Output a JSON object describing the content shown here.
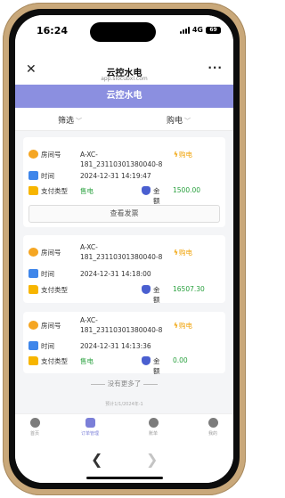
{
  "status_bar": {
    "time": "16:24",
    "network": "4G",
    "battery": "69"
  },
  "nav": {
    "title": "云控水电",
    "subtitle": "app.slocubxl.com",
    "close_label": "✕",
    "more_label": "···"
  },
  "header": {
    "title": "云控水电"
  },
  "filters": {
    "left": "筛选",
    "right": "购电"
  },
  "labels": {
    "room": "房间号",
    "time": "时间",
    "pay_type": "支付类型",
    "amount": "金额"
  },
  "records": [
    {
      "room": "A-XC-181_23110301380040-8",
      "time": "2024-12-31 14:19:47",
      "pay_type": "售电",
      "amount": "1500.00",
      "tag": "购电"
    },
    {
      "room": "A-XC-181_23110301380040-8",
      "time": "2024-12-31 14:18:00",
      "pay_type": "",
      "amount": "16507.30",
      "tag": "购电"
    },
    {
      "room": "A-XC-181_23110301380040-8",
      "time": "2024-12-31 14:13:36",
      "pay_type": "售电",
      "amount": "0.00",
      "tag": "购电"
    }
  ],
  "invoice_button": "查看发票",
  "footer": {
    "no_more": "没有更多了",
    "record_hint": "预计1/1/2024年-1"
  },
  "tabs": [
    {
      "label": "首页",
      "icon": "home-icon"
    },
    {
      "label": "订单管理",
      "icon": "orders-icon"
    },
    {
      "label": "账单",
      "icon": "bill-icon"
    },
    {
      "label": "我的",
      "icon": "profile-icon"
    }
  ],
  "colors": {
    "banner": "#8b8fe0",
    "accent_green": "#2aa13f",
    "tag_orange": "#f0a000",
    "active_tab": "#7b7fd8"
  }
}
